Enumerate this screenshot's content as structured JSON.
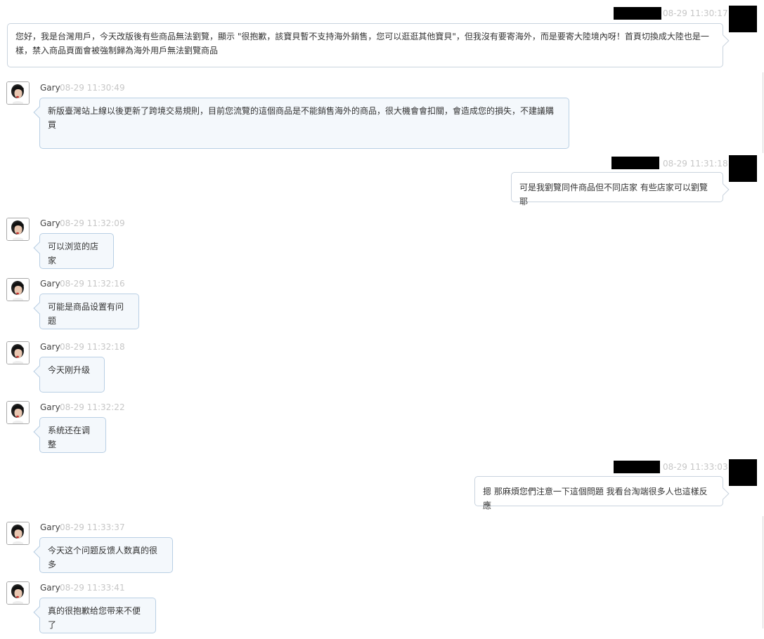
{
  "conversation": {
    "agent_name": "Gary",
    "messages": [
      {
        "sender": "self",
        "timestamp": "08-29 11:30:17",
        "text": "您好，我是台灣用戶，今天改版後有些商品無法劉覽，顯示 \"很抱歉，該寶貝暫不支持海外銷售，您可以逛逛其他寶貝\"，但我沒有要寄海外，而是要寄大陸境內呀！首頁切換成大陸也是一樣，禁入商品頁面會被強制歸為海外用戶無法劉覽商品"
      },
      {
        "sender": "agent",
        "timestamp": "08-29 11:30:49",
        "text": "新版臺灣站上線以後更新了跨境交易規則，目前您流覽的這個商品是不能銷售海外的商品，很大機會會扣關，會造成您的損失，不建議購買"
      },
      {
        "sender": "self",
        "timestamp": "08-29 11:31:18",
        "text": "可是我劉覽同件商品但不同店家 有些店家可以劉覽耶"
      },
      {
        "sender": "agent",
        "timestamp": "08-29 11:32:09",
        "text": "可以浏览的店家"
      },
      {
        "sender": "agent",
        "timestamp": "08-29 11:32:16",
        "text": "可能是商品设置有问题"
      },
      {
        "sender": "agent",
        "timestamp": "08-29 11:32:18",
        "text": "今天刚升级"
      },
      {
        "sender": "agent",
        "timestamp": "08-29 11:32:22",
        "text": "系统还在调整"
      },
      {
        "sender": "self",
        "timestamp": "08-29 11:33:03",
        "text": "摁 那麻煩您們注意一下這個問題 我看台淘端很多人也這樣反應"
      },
      {
        "sender": "agent",
        "timestamp": "08-29 11:33:37",
        "text": "今天这个问题反馈人数真的很多"
      },
      {
        "sender": "agent",
        "timestamp": "08-29 11:33:41",
        "text": "真的很抱歉给您带来不便了"
      }
    ]
  }
}
